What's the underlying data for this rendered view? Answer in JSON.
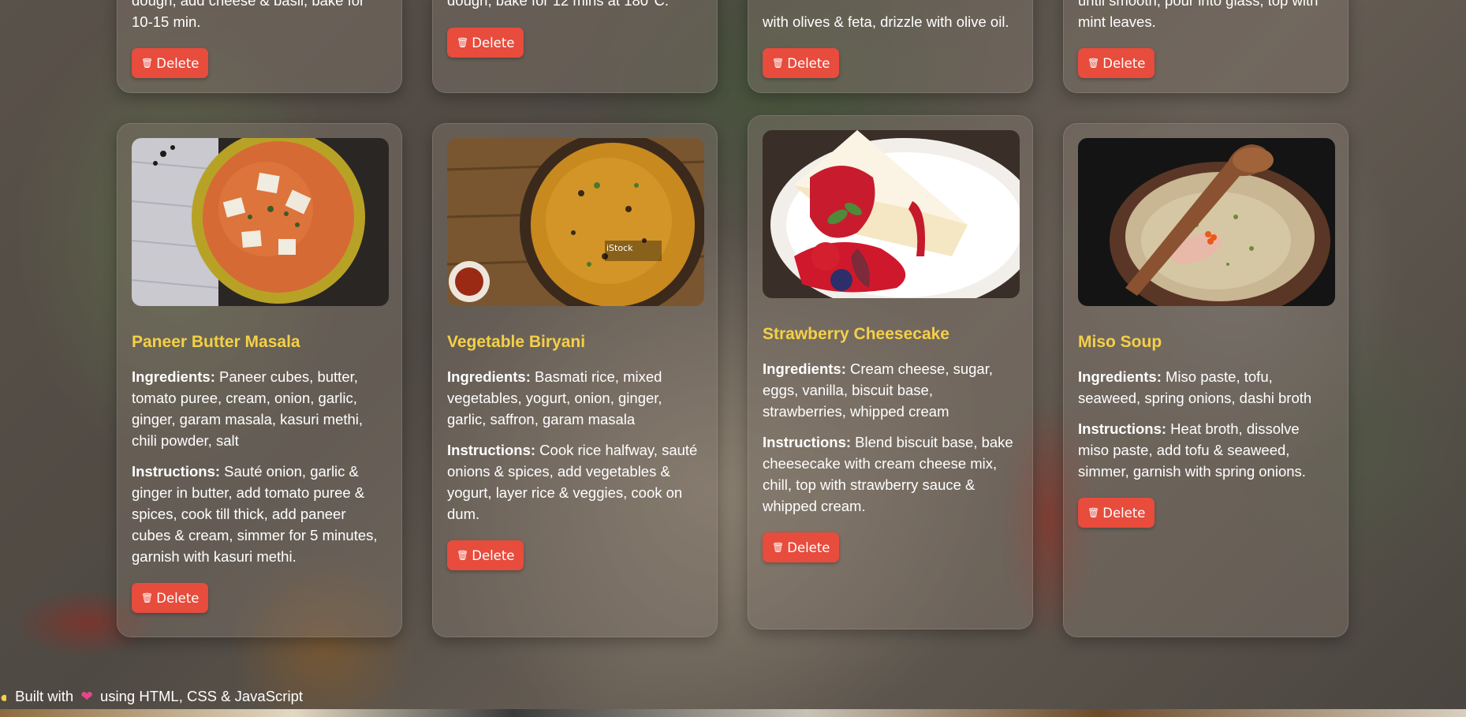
{
  "top_row": [
    {
      "snippet": "dough, add cheese & basil, bake for 10-15 min.",
      "delete_label": "Delete"
    },
    {
      "snippet": "dough, bake for 12 mins at 180°C.",
      "delete_label": "Delete"
    },
    {
      "snippet": "with olives & feta, drizzle with olive oil.",
      "delete_label": "Delete"
    },
    {
      "snippet": "until smooth, pour into glass, top with mint leaves.",
      "delete_label": "Delete"
    }
  ],
  "recipes": [
    {
      "title": "Paneer Butter Masala",
      "ingredients_label": "Ingredients:",
      "ingredients": "Paneer cubes, butter, tomato puree, cream, onion, garlic, ginger, garam masala, kasuri methi, chili powder, salt",
      "instructions_label": "Instructions:",
      "instructions": "Sauté onion, garlic & ginger in butter, add tomato puree & spices, cook till thick, add paneer cubes & cream, simmer for 5 minutes, garnish with kasuri methi.",
      "delete_label": "Delete",
      "image_icon": "paneer-curry-photo"
    },
    {
      "title": "Vegetable Biryani",
      "ingredients_label": "Ingredients:",
      "ingredients": "Basmati rice, mixed vegetables, yogurt, onion, ginger, garlic, saffron, garam masala",
      "instructions_label": "Instructions:",
      "instructions": "Cook rice halfway, sauté onions & spices, add vegetables & yogurt, layer rice & veggies, cook on dum.",
      "delete_label": "Delete",
      "image_icon": "biryani-photo",
      "image_watermark": "iStock"
    },
    {
      "title": "Strawberry Cheesecake",
      "ingredients_label": "Ingredients:",
      "ingredients": "Cream cheese, sugar, eggs, vanilla, biscuit base, strawberries, whipped cream",
      "instructions_label": "Instructions:",
      "instructions": "Blend biscuit base, bake cheesecake with cream cheese mix, chill, top with strawberry sauce & whipped cream.",
      "delete_label": "Delete",
      "image_icon": "cheesecake-photo"
    },
    {
      "title": "Miso Soup",
      "ingredients_label": "Ingredients:",
      "ingredients": "Miso paste, tofu, seaweed, spring onions, dashi broth",
      "instructions_label": "Instructions:",
      "instructions": "Heat broth, dissolve miso paste, add tofu & seaweed, simmer, garnish with spring onions.",
      "delete_label": "Delete",
      "image_icon": "miso-soup-photo"
    }
  ],
  "footer": {
    "prefix": "Built with",
    "suffix": "using HTML, CSS & JavaScript",
    "heart_icon": "heart-icon",
    "bulb_icon": "lightbulb-icon"
  },
  "colors": {
    "title": "#f5d046",
    "delete_button": "#e74c3c",
    "text": "#ffffff"
  }
}
